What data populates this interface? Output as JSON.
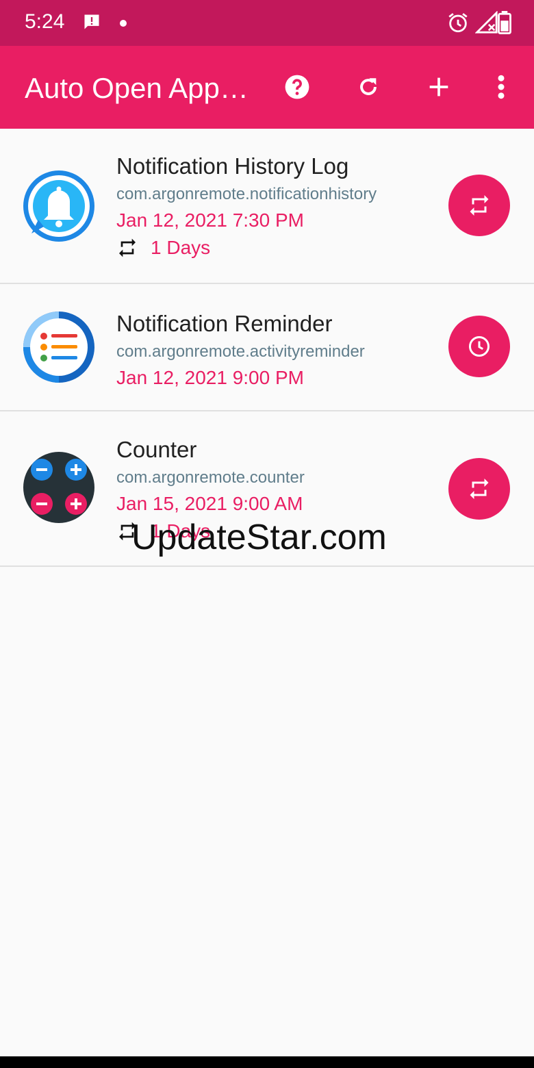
{
  "status_bar": {
    "time": "5:24",
    "left_icons": [
      "message-alert-icon",
      "dot-icon"
    ],
    "right_icons": [
      "alarm-icon",
      "signal-no-data-icon",
      "battery-icon"
    ]
  },
  "app_bar": {
    "title": "Auto Open App…",
    "actions": [
      "help-icon",
      "refresh-icon",
      "add-icon",
      "more-vert-icon"
    ]
  },
  "items": [
    {
      "title": "Notification History Log",
      "package": "com.argonremote.notificationhistory",
      "date": "Jan 12, 2021 7:30 PM",
      "repeat": "1 Days",
      "action_icon": "repeat-icon"
    },
    {
      "title": "Notification Reminder",
      "package": "com.argonremote.activityreminder",
      "date": "Jan 12, 2021 9:00 PM",
      "action_icon": "clock-icon"
    },
    {
      "title": "Counter",
      "package": "com.argonremote.counter",
      "date": "Jan 15, 2021 9:00 AM",
      "repeat": "1 Days",
      "action_icon": "repeat-icon"
    }
  ],
  "watermark": "UpdateStar.com",
  "colors": {
    "status_bar": "#c2185b",
    "app_bar": "#e91e63",
    "accent": "#e91e63",
    "package_text": "#607d8b"
  }
}
